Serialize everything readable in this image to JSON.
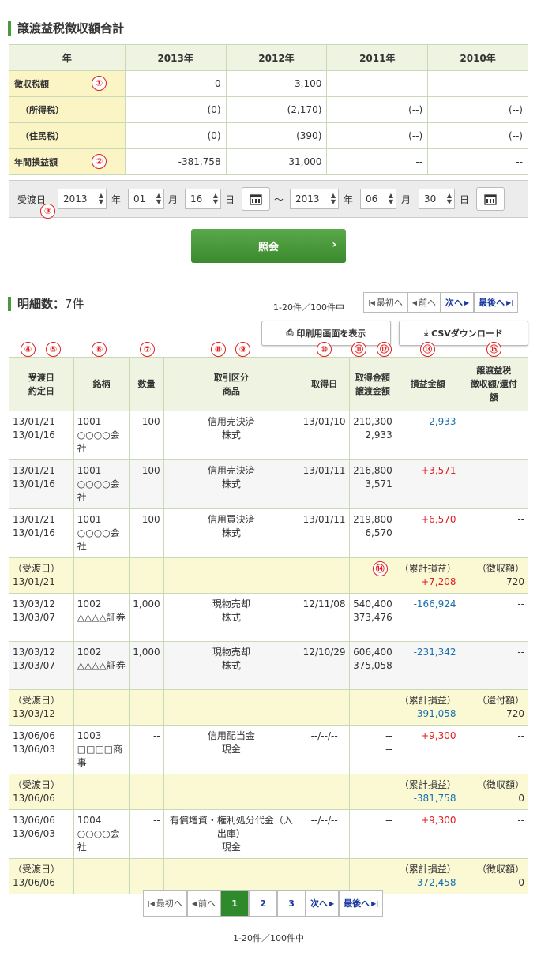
{
  "summary": {
    "title": "譲渡益税徴収額合計",
    "header": [
      "年",
      "2013年",
      "2012年",
      "2011年",
      "2010年"
    ],
    "rows": [
      {
        "label": "徴収税額",
        "values": [
          "0",
          "3,100",
          "--",
          "--"
        ]
      },
      {
        "label": "（所得税）",
        "values": [
          "(0)",
          "(2,170)",
          "(--)",
          "(--)"
        ]
      },
      {
        "label": "（住民税）",
        "values": [
          "(0)",
          "(390)",
          "(--)",
          "(--)"
        ]
      },
      {
        "label": "年間損益額",
        "values": [
          "-381,758",
          "31,000",
          "--",
          "--"
        ]
      }
    ]
  },
  "filter": {
    "label": "受渡日",
    "from": {
      "year": "2013",
      "month": "01",
      "day": "16"
    },
    "to": {
      "year": "2013",
      "month": "06",
      "day": "30"
    },
    "year_unit": "年",
    "month_unit": "月",
    "day_unit": "日",
    "tilde": "～",
    "submit": "照会"
  },
  "detail": {
    "title": "明細数：",
    "count": "7件",
    "range": "1-20件／100件中",
    "print_btn": "印刷用画面を表示",
    "csv_btn": "CSVダウンロード",
    "headers": [
      "受渡日\n約定日",
      "銘柄",
      "数量",
      "取引区分\n商品",
      "取得日",
      "取得金額\n譲渡金額",
      "損益金額",
      "譲渡益税\n徴収額/還付\n額"
    ],
    "rows": [
      {
        "type": "row",
        "d1": "13/01/21",
        "d2": "13/01/16",
        "code": "1001",
        "name": "○○○○会社",
        "qty": "100",
        "k1": "信用売決済",
        "k2": "株式",
        "acq": "13/01/10",
        "a1": "210,300",
        "a2": "2,933",
        "pl": "-2,933",
        "pl_sign": "neg",
        "tax": "--"
      },
      {
        "type": "row",
        "d1": "13/01/21",
        "d2": "13/01/16",
        "code": "1001",
        "name": "○○○○会社",
        "qty": "100",
        "k1": "信用売決済",
        "k2": "株式",
        "acq": "13/01/11",
        "a1": "216,800",
        "a2": "3,571",
        "pl": "+3,571",
        "pl_sign": "pos",
        "tax": "--"
      },
      {
        "type": "row",
        "d1": "13/01/21",
        "d2": "13/01/16",
        "code": "1001",
        "name": "○○○○会社",
        "qty": "100",
        "k1": "信用買決済",
        "k2": "株式",
        "acq": "13/01/11",
        "a1": "219,800",
        "a2": "6,570",
        "pl": "+6,570",
        "pl_sign": "pos",
        "tax": "--"
      },
      {
        "type": "sub",
        "d1": "（受渡日）",
        "d2": "13/01/21",
        "pl1": "（累計損益）",
        "pl": "+7,208",
        "pl_sign": "pos",
        "t1": "（徴収額）",
        "tax": "720"
      },
      {
        "type": "row",
        "d1": "13/03/12",
        "d2": "13/03/07",
        "code": "1002",
        "name": "△△△△証券",
        "qty": "1,000",
        "k1": "現物売却",
        "k2": "株式",
        "acq": "12/11/08",
        "a1": "540,400",
        "a2": "373,476",
        "pl": "-166,924",
        "pl_sign": "neg",
        "tax": "--"
      },
      {
        "type": "row",
        "d1": "13/03/12",
        "d2": "13/03/07",
        "code": "1002",
        "name": "△△△△証券",
        "qty": "1,000",
        "k1": "現物売却",
        "k2": "株式",
        "acq": "12/10/29",
        "a1": "606,400",
        "a2": "375,058",
        "pl": "-231,342",
        "pl_sign": "neg",
        "tax": "--"
      },
      {
        "type": "sub",
        "d1": "（受渡日）",
        "d2": "13/03/12",
        "pl1": "（累計損益）",
        "pl": "-391,058",
        "pl_sign": "neg",
        "t1": "（還付額）",
        "tax": "720"
      },
      {
        "type": "row",
        "d1": "13/06/06",
        "d2": "13/06/03",
        "code": "1003",
        "name": "□□□□商事",
        "qty": "--",
        "k1": "信用配当金",
        "k2": "現金",
        "acq": "--/--/--",
        "a1": "--",
        "a2": "--",
        "pl": "+9,300",
        "pl_sign": "pos",
        "tax": "--"
      },
      {
        "type": "sub",
        "d1": "（受渡日）",
        "d2": "13/06/06",
        "pl1": "（累計損益）",
        "pl": "-381,758",
        "pl_sign": "neg",
        "t1": "（徴収額）",
        "tax": "0"
      },
      {
        "type": "row",
        "d1": "13/06/06",
        "d2": "13/06/03",
        "code": "1004",
        "name": "○○○○会社",
        "qty": "--",
        "k1": "有償増資・権利処分代金（入出庫）",
        "k2": "現金",
        "acq": "--/--/--",
        "a1": "--",
        "a2": "--",
        "pl": "+9,300",
        "pl_sign": "pos",
        "tax": "--"
      },
      {
        "type": "sub",
        "d1": "（受渡日）",
        "d2": "13/06/06",
        "pl1": "（累計損益）",
        "pl": "-372,458",
        "pl_sign": "neg",
        "t1": "（徴収額）",
        "tax": "0"
      }
    ]
  },
  "pager": {
    "first": "最初へ",
    "prev": "前へ",
    "next": "次へ",
    "last": "最後へ",
    "pages": [
      "1",
      "2",
      "3"
    ],
    "range": "1-20件／100件中"
  },
  "markers": [
    "①",
    "②",
    "③",
    "④",
    "⑤",
    "⑥",
    "⑦",
    "⑧",
    "⑨",
    "⑩",
    "⑪",
    "⑫",
    "⑬",
    "⑭",
    "⑮"
  ],
  "colors": {
    "accent": "#4a9a3a",
    "button": "#3b8a2d",
    "negative": "#1a6fb0",
    "positive": "#e02020",
    "marker": "#e02020"
  }
}
